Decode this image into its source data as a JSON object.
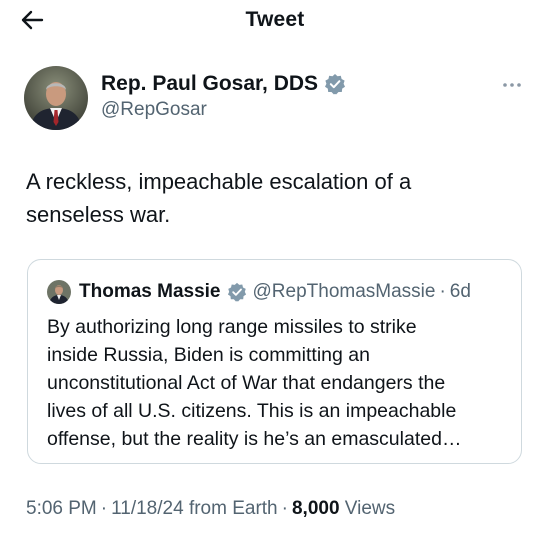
{
  "header": {
    "title": "Tweet",
    "back_icon": "arrow-left-icon"
  },
  "author": {
    "name": "Rep. Paul Gosar, DDS",
    "handle": "@RepGosar",
    "verified_icon": "verified-badge-icon",
    "more_icon": "more-horizontal-icon"
  },
  "tweet": {
    "lines": [
      "A reckless, impeachable escalation of a",
      "senseless war."
    ]
  },
  "quote": {
    "name": "Thomas Massie",
    "handle": "@RepThomasMassie",
    "separator": "·",
    "age": "6d",
    "lines": [
      "By authorizing long range missiles to strike",
      "inside Russia, Biden is committing  an",
      "unconstitutional Act of War that endangers the",
      "lives of all U.S. citizens. This is an impeachable",
      "offense, but the reality is he’s an emasculated…"
    ]
  },
  "meta": {
    "time": "5:06 PM",
    "date": "11/18/24",
    "source": "from Earth",
    "separator": "·",
    "views_count": "8,000",
    "views_label": "Views"
  },
  "colors": {
    "text": "#0f1419",
    "secondary": "#536471",
    "verified": "#829aab",
    "border": "#cfd9de"
  }
}
